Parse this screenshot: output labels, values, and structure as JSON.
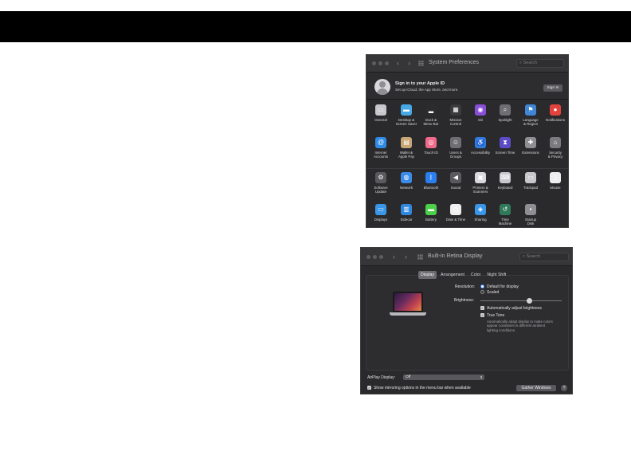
{
  "prefs": {
    "title": "System Preferences",
    "search_placeholder": "Search",
    "nav_back": "‹",
    "nav_forward": "›",
    "apple_id_title": "Sign in to your Apple ID",
    "apple_id_subtitle": "Set up iCloud, the App Store, and more.",
    "sign_in": "Sign In",
    "row1": [
      {
        "label": "General",
        "icon": "general-icon",
        "color": "#c7c7cc"
      },
      {
        "label": "Desktop &\nScreen Saver",
        "icon": "desktop-screensaver-icon",
        "color": "#47a8e6"
      },
      {
        "label": "Dock &\nMenu Bar",
        "icon": "dock-menubar-icon",
        "color": "#2c2c2e"
      },
      {
        "label": "Mission\nControl",
        "icon": "mission-control-icon",
        "color": "#3a3a3c"
      },
      {
        "label": "Siri",
        "icon": "siri-icon",
        "color": "#8a4fd8"
      },
      {
        "label": "Spotlight",
        "icon": "spotlight-icon",
        "color": "#6e6e73"
      },
      {
        "label": "Language\n& Region",
        "icon": "language-region-icon",
        "color": "#3f86d6"
      },
      {
        "label": "Notifications",
        "icon": "notifications-icon",
        "color": "#e0443c"
      }
    ],
    "row2": [
      {
        "label": "Internet\nAccounts",
        "icon": "internet-accounts-icon",
        "color": "#2f8be6"
      },
      {
        "label": "Wallet &\nApple Pay",
        "icon": "wallet-icon",
        "color": "#c9a774"
      },
      {
        "label": "Touch ID",
        "icon": "touch-id-icon",
        "color": "#f06a8a"
      },
      {
        "label": "Users &\nGroups",
        "icon": "users-groups-icon",
        "color": "#6e6e73"
      },
      {
        "label": "Accessibility",
        "icon": "accessibility-icon",
        "color": "#2f7de0"
      },
      {
        "label": "Screen Time",
        "icon": "screen-time-icon",
        "color": "#5b4bc4"
      },
      {
        "label": "Extensions",
        "icon": "extensions-icon",
        "color": "#8e8e93"
      },
      {
        "label": "Security\n& Privacy",
        "icon": "security-privacy-icon",
        "color": "#7a7a7f"
      }
    ],
    "row3": [
      {
        "label": "Software\nUpdate",
        "icon": "software-update-icon",
        "color": "#5a5a5e"
      },
      {
        "label": "Network",
        "icon": "network-icon",
        "color": "#3b8be8"
      },
      {
        "label": "Bluetooth",
        "icon": "bluetooth-icon",
        "color": "#2a7ef0"
      },
      {
        "label": "Sound",
        "icon": "sound-icon",
        "color": "#5a5a5e"
      },
      {
        "label": "Printers &\nScanners",
        "icon": "printers-scanners-icon",
        "color": "#d8d8dc"
      },
      {
        "label": "Keyboard",
        "icon": "keyboard-icon",
        "color": "#c7c7cc"
      },
      {
        "label": "Trackpad",
        "icon": "trackpad-icon",
        "color": "#c7c7cc"
      },
      {
        "label": "Mouse",
        "icon": "mouse-icon",
        "color": "#eeeeee"
      }
    ],
    "row4": [
      {
        "label": "Displays",
        "icon": "displays-icon",
        "color": "#3a96e8"
      },
      {
        "label": "Sidecar",
        "icon": "sidecar-icon",
        "color": "#2f87e0"
      },
      {
        "label": "Battery",
        "icon": "battery-icon",
        "color": "#4cd04a"
      },
      {
        "label": "Date & Time",
        "icon": "date-time-icon",
        "color": "#eeeeee"
      },
      {
        "label": "Sharing",
        "icon": "sharing-icon",
        "color": "#3a96e8"
      },
      {
        "label": "Time\nMachine",
        "icon": "time-machine-icon",
        "color": "#2f7a5a"
      },
      {
        "label": "Startup\nDisk",
        "icon": "startup-disk-icon",
        "color": "#8e8e93"
      }
    ]
  },
  "displays": {
    "title": "Built-in Retina Display",
    "search_placeholder": "Search",
    "nav_back": "‹",
    "nav_forward": "›",
    "tabs": [
      "Display",
      "Arrangement",
      "Color",
      "Night Shift"
    ],
    "resolution_label": "Resolution:",
    "resolution_default": "Default for display",
    "resolution_scaled": "Scaled",
    "brightness_label": "Brightness:",
    "brightness_level": 0.6,
    "auto_brightness": "Automatically adjust brightness",
    "true_tone": "True Tone",
    "true_tone_desc": "Automatically adapt display to make colors appear consistent in different ambient lighting conditions.",
    "airplay_label": "AirPlay Display:",
    "airplay_value": "Off",
    "mirroring_label": "Show mirroring options in the menu bar when available",
    "gather_windows": "Gather Windows",
    "help": "?"
  }
}
